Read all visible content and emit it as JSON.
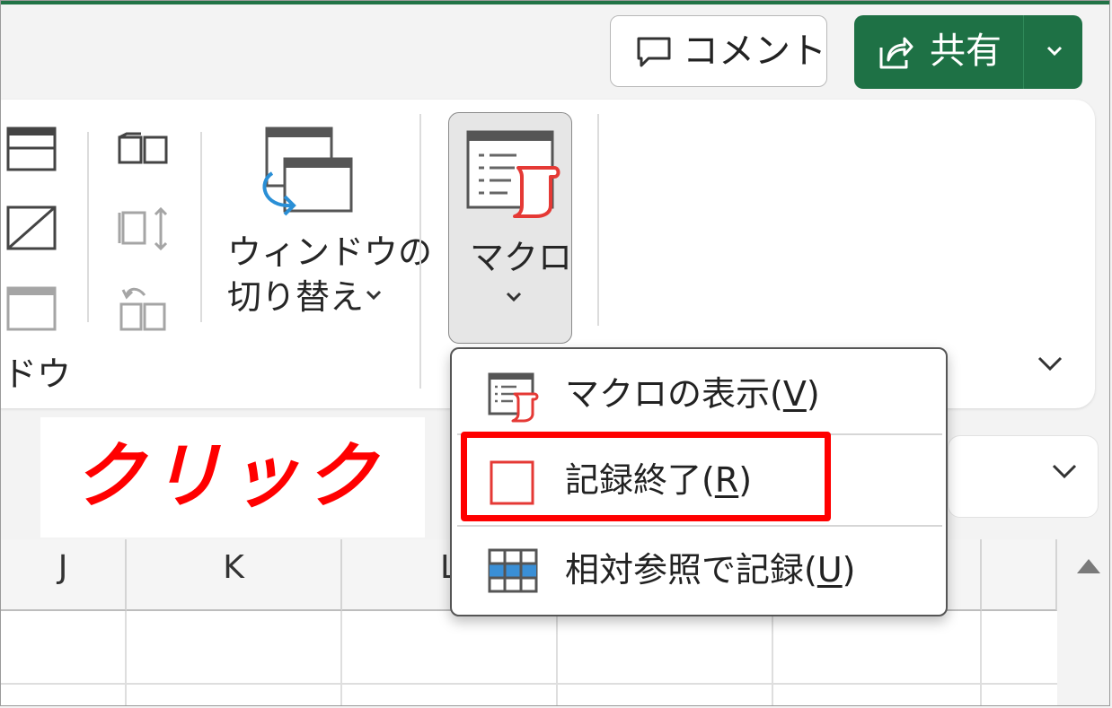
{
  "titlebar": {
    "comment_label": "コメント",
    "share_label": "共有"
  },
  "ribbon": {
    "window_group_label": "ドウ",
    "switch_windows_line1": "ウィンドウの",
    "switch_windows_line2": "切り替え",
    "macro_label": "マクロ"
  },
  "annotation": {
    "click_label": "クリック"
  },
  "grid": {
    "columns": [
      "J",
      "K",
      "L"
    ]
  },
  "macro_menu": {
    "items": [
      {
        "label_prefix": "マクロの表示(",
        "accel": "V",
        "label_suffix": ")",
        "icon": "macro-list-icon"
      },
      {
        "label_prefix": "記録終了(",
        "accel": "R",
        "label_suffix": ")",
        "icon": "stop-recording-icon"
      },
      {
        "label_prefix": "相対参照で記録(",
        "accel": "U",
        "label_suffix": ")",
        "icon": "relative-reference-icon"
      }
    ]
  },
  "colors": {
    "share_green": "#1e7145",
    "highlight_red": "#ff0000",
    "macro_accent": "#e53935",
    "relative_blue": "#3a8fd6"
  }
}
